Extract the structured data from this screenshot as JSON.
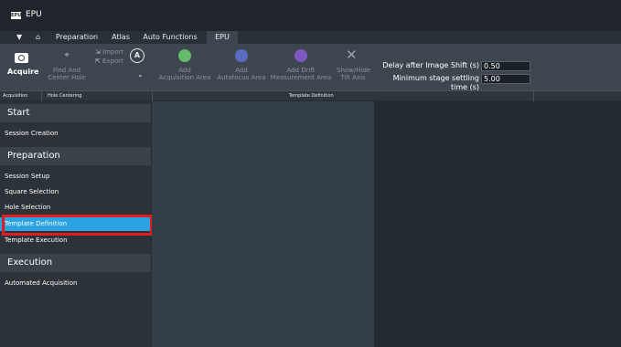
{
  "app": {
    "logo_text": "EPU",
    "title": "EPU"
  },
  "tabs": [
    {
      "label": "Preparation"
    },
    {
      "label": "Atlas"
    },
    {
      "label": "Auto Functions"
    },
    {
      "label": "EPU",
      "active": true
    }
  ],
  "ribbon": {
    "acquire": {
      "label": "Acquire"
    },
    "find_center": {
      "line1": "Find And",
      "line2": "Center Hole"
    },
    "import_label": "Import",
    "export_label": "Export",
    "auto_icon_glyph": "A",
    "add_acquisition": {
      "line1": "Add",
      "line2": "Acquisition Area",
      "color": "#66bb6a"
    },
    "add_autofocus": {
      "line1": "Add",
      "line2": "Autofocus Area",
      "color": "#5c6bc0"
    },
    "add_drift": {
      "line1": "Add Drift",
      "line2": "Measurement Area",
      "color": "#7e57c2"
    },
    "tilt_axis": {
      "line1": "Show/Hide",
      "line2": "Tilt Axis"
    },
    "delay_label": "Delay after Image Shift (s)",
    "delay_value": "0.50",
    "settling_label": "Minimum stage settling time (s)",
    "settling_value": "5.00"
  },
  "ribbon_footer": {
    "acquisition": "Acquisition",
    "hole_centering": "Hole Centering",
    "template_definition": "Template Definition"
  },
  "sidebar": {
    "sections": [
      {
        "title": "Start",
        "items": [
          "Session Creation"
        ]
      },
      {
        "title": "Preparation",
        "items": [
          "Session Setup",
          "Square Selection",
          "Hole Selection",
          "Template Definition",
          "Template Execution"
        ]
      },
      {
        "title": "Execution",
        "items": [
          "Automated Acquisition"
        ]
      }
    ],
    "active_item": "Template Definition"
  },
  "colors": {
    "accent": "#2aa3e0",
    "highlight": "#e21d22"
  }
}
